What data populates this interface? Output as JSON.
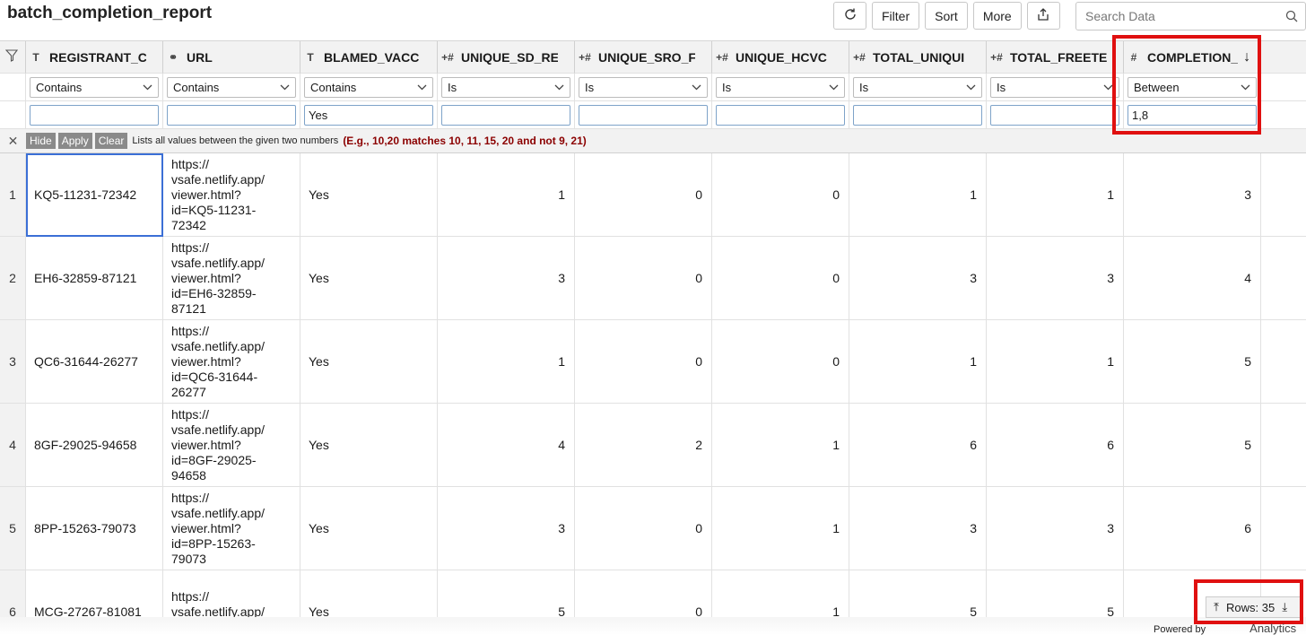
{
  "title": "batch_completion_report",
  "toolbar": {
    "refresh_icon": "refresh-icon",
    "filter_label": "Filter",
    "sort_label": "Sort",
    "more_label": "More",
    "export_icon": "export-icon"
  },
  "search": {
    "placeholder": "Search Data"
  },
  "columns": [
    {
      "type": "T",
      "name": "REGISTRANT_C"
    },
    {
      "type": "⚭",
      "name": "URL"
    },
    {
      "type": "T",
      "name": "BLAMED_VACC"
    },
    {
      "type": "+#",
      "name": "UNIQUE_SD_RE"
    },
    {
      "type": "+#",
      "name": "UNIQUE_SRO_F"
    },
    {
      "type": "+#",
      "name": "UNIQUE_HCVC"
    },
    {
      "type": "+#",
      "name": "TOTAL_UNIQUI"
    },
    {
      "type": "+#",
      "name": "TOTAL_FREETE"
    },
    {
      "type": "#",
      "name": "COMPLETION_",
      "sort": "↓"
    }
  ],
  "filters": {
    "operators": [
      "Contains",
      "Contains",
      "Contains",
      "Is",
      "Is",
      "Is",
      "Is",
      "Is",
      "Between"
    ],
    "values": [
      "",
      "",
      "Yes",
      "",
      "",
      "",
      "",
      "",
      "1,8"
    ]
  },
  "filter_help": {
    "hide": "Hide",
    "apply": "Apply",
    "clear": "Clear",
    "hint": "Lists all values between the given two numbers",
    "example": "(E.g., 10,20 matches 10, 11, 15, 20 and not 9, 21)"
  },
  "rows": [
    {
      "n": "1",
      "reg": "KQ5-11231-72342",
      "url": "https://\nvsafe.netlify.app/\nviewer.html?\nid=KQ5-11231-\n72342",
      "blamed": "Yes",
      "sd": "1",
      "sro": "0",
      "hcvc": "0",
      "total_u": "1",
      "total_f": "1",
      "completion": "3"
    },
    {
      "n": "2",
      "reg": "EH6-32859-87121",
      "url": "https://\nvsafe.netlify.app/\nviewer.html?\nid=EH6-32859-\n87121",
      "blamed": "Yes",
      "sd": "3",
      "sro": "0",
      "hcvc": "0",
      "total_u": "3",
      "total_f": "3",
      "completion": "4"
    },
    {
      "n": "3",
      "reg": "QC6-31644-26277",
      "url": "https://\nvsafe.netlify.app/\nviewer.html?\nid=QC6-31644-\n26277",
      "blamed": "Yes",
      "sd": "1",
      "sro": "0",
      "hcvc": "0",
      "total_u": "1",
      "total_f": "1",
      "completion": "5"
    },
    {
      "n": "4",
      "reg": "8GF-29025-94658",
      "url": "https://\nvsafe.netlify.app/\nviewer.html?\nid=8GF-29025-\n94658",
      "blamed": "Yes",
      "sd": "4",
      "sro": "2",
      "hcvc": "1",
      "total_u": "6",
      "total_f": "6",
      "completion": "5"
    },
    {
      "n": "5",
      "reg": "8PP-15263-79073",
      "url": "https://\nvsafe.netlify.app/\nviewer.html?\nid=8PP-15263-\n79073",
      "blamed": "Yes",
      "sd": "3",
      "sro": "0",
      "hcvc": "1",
      "total_u": "3",
      "total_f": "3",
      "completion": "6"
    },
    {
      "n": "6",
      "reg": "MCG-27267-81081",
      "url": "https://\nvsafe.netlify.app/\nviewer.html?",
      "blamed": "Yes",
      "sd": "5",
      "sro": "0",
      "hcvc": "1",
      "total_u": "5",
      "total_f": "5",
      "completion": ""
    }
  ],
  "rows_count": "Rows: 35",
  "footer": {
    "powered": "Powered by",
    "brand": "Analytics"
  },
  "colors": {
    "highlight": "#e01010",
    "selected_cell": "#3b6fd6",
    "hint_example": "#8b0000"
  }
}
